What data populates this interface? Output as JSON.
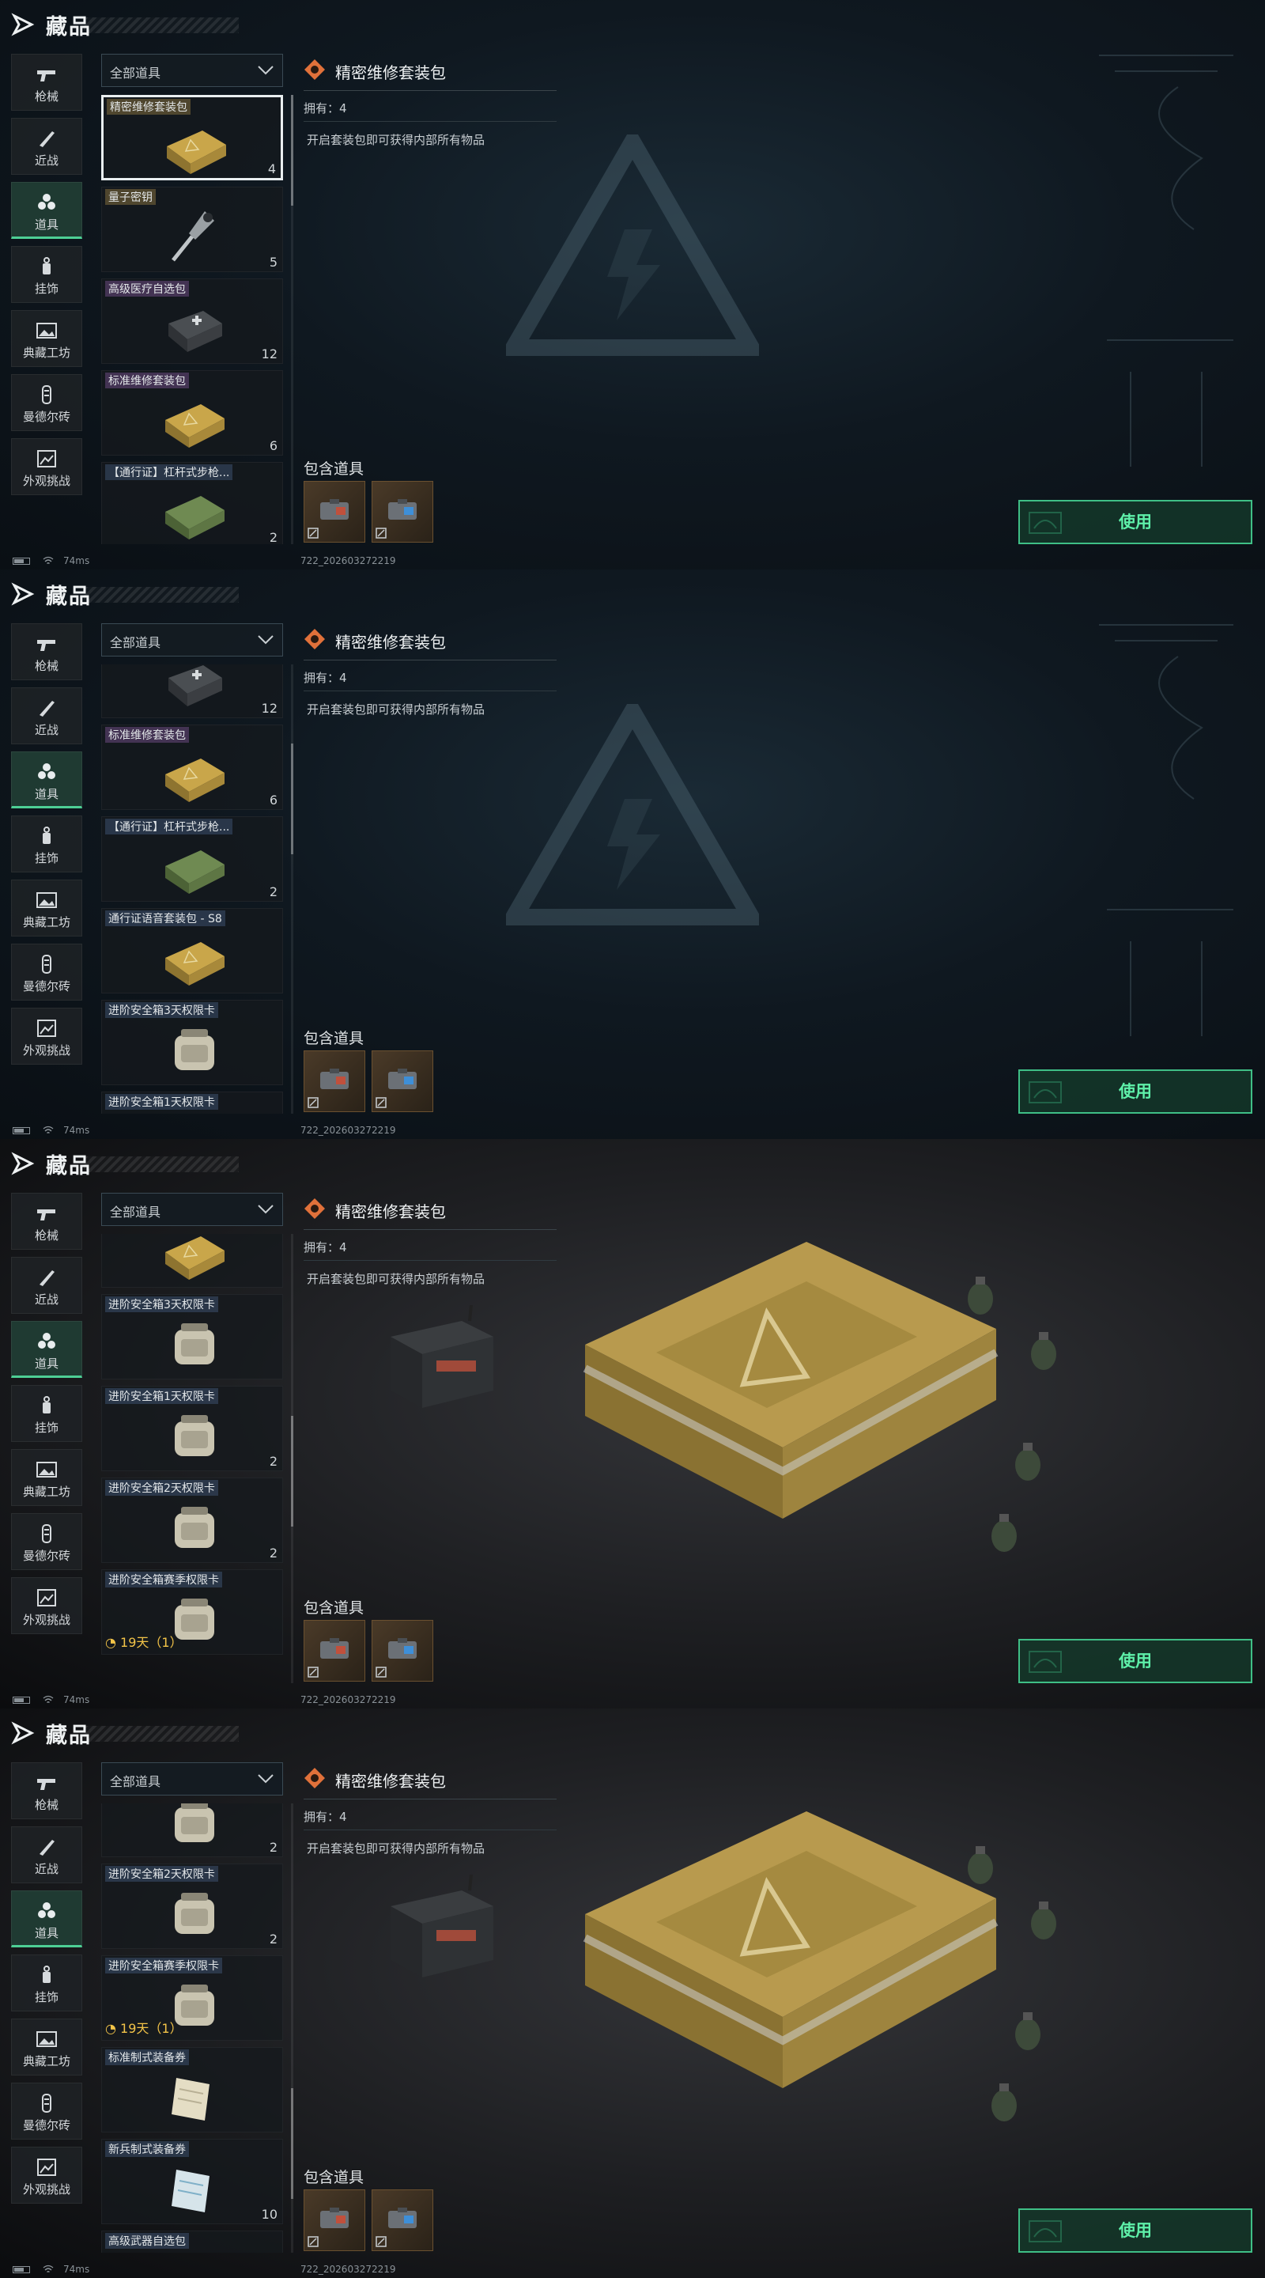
{
  "header": {
    "title": "藏品"
  },
  "nav": [
    {
      "label": "枪械",
      "icon": "gun-icon"
    },
    {
      "label": "近战",
      "icon": "knife-icon"
    },
    {
      "label": "道具",
      "icon": "items-icon",
      "active": true
    },
    {
      "label": "挂饰",
      "icon": "charm-icon"
    },
    {
      "label": "典藏工坊",
      "icon": "gallery-icon"
    },
    {
      "label": "曼德尔砖",
      "icon": "brick-icon"
    },
    {
      "label": "外观挑战",
      "icon": "challenge-icon"
    }
  ],
  "filter": {
    "label": "全部道具"
  },
  "detail": {
    "title": "精密维修套装包",
    "owned": "拥有：4",
    "description": "开启套装包即可获得内部所有物品",
    "includes_label": "包含道具",
    "included_items": [
      "repair-kit-icon",
      "repair-kit-blue-icon"
    ]
  },
  "use_button": {
    "label": "使用"
  },
  "status": {
    "latency": "74ms",
    "build": "722_202603272219"
  },
  "panels": [
    {
      "scroll": 0,
      "items": [
        {
          "name": "精密维修套装包",
          "qty": "4",
          "style": "gold",
          "selected": true,
          "thumb": "crate"
        },
        {
          "name": "量子密钥",
          "qty": "5",
          "style": "gold",
          "thumb": "key"
        },
        {
          "name": "高级医疗自选包",
          "qty": "12",
          "style": "purple",
          "thumb": "medkit"
        },
        {
          "name": "标准维修套装包",
          "qty": "6",
          "style": "purple",
          "thumb": "crate"
        },
        {
          "name": "【通行证】杠杆式步枪...",
          "qty": "2",
          "style": "blue",
          "thumb": "crate-green"
        }
      ]
    },
    {
      "scroll": 1,
      "items": [
        {
          "name": "",
          "qty": "12",
          "style": "none",
          "thumb": "medkit",
          "partial": true
        },
        {
          "name": "标准维修套装包",
          "qty": "6",
          "style": "purple",
          "thumb": "crate"
        },
        {
          "name": "【通行证】杠杆式步枪...",
          "qty": "2",
          "style": "blue",
          "thumb": "crate-green"
        },
        {
          "name": "通行证语音套装包 - S8",
          "qty": "",
          "style": "blue",
          "thumb": "crate"
        },
        {
          "name": "进阶安全箱3天权限卡",
          "qty": "",
          "style": "blue",
          "thumb": "case"
        },
        {
          "name": "进阶安全箱1天权限卡",
          "qty": "",
          "style": "blue",
          "thumb": "case"
        }
      ]
    },
    {
      "scroll": 2,
      "photo": true,
      "items": [
        {
          "name": "",
          "qty": "",
          "style": "none",
          "thumb": "crate",
          "partial": true
        },
        {
          "name": "进阶安全箱3天权限卡",
          "qty": "",
          "style": "blue",
          "thumb": "case"
        },
        {
          "name": "进阶安全箱1天权限卡",
          "qty": "2",
          "style": "blue",
          "thumb": "case"
        },
        {
          "name": "进阶安全箱2天权限卡",
          "qty": "2",
          "style": "blue",
          "thumb": "case"
        },
        {
          "name": "进阶安全箱赛季权限卡",
          "qty": "",
          "style": "blue",
          "thumb": "case",
          "timer": "19天（1）"
        }
      ]
    },
    {
      "scroll": 3,
      "photo": true,
      "items": [
        {
          "name": "",
          "qty": "2",
          "style": "none",
          "thumb": "case",
          "partial": true
        },
        {
          "name": "进阶安全箱2天权限卡",
          "qty": "2",
          "style": "blue",
          "thumb": "case"
        },
        {
          "name": "进阶安全箱赛季权限卡",
          "qty": "",
          "style": "blue",
          "thumb": "case",
          "timer": "19天（1）"
        },
        {
          "name": "标准制式装备券",
          "qty": "",
          "style": "blue",
          "thumb": "ticket"
        },
        {
          "name": "新兵制式装备券",
          "qty": "10",
          "style": "blue",
          "thumb": "ticket-blue"
        },
        {
          "name": "高级武器自选包",
          "qty": "",
          "style": "blue",
          "thumb": "medkit"
        }
      ]
    }
  ]
}
